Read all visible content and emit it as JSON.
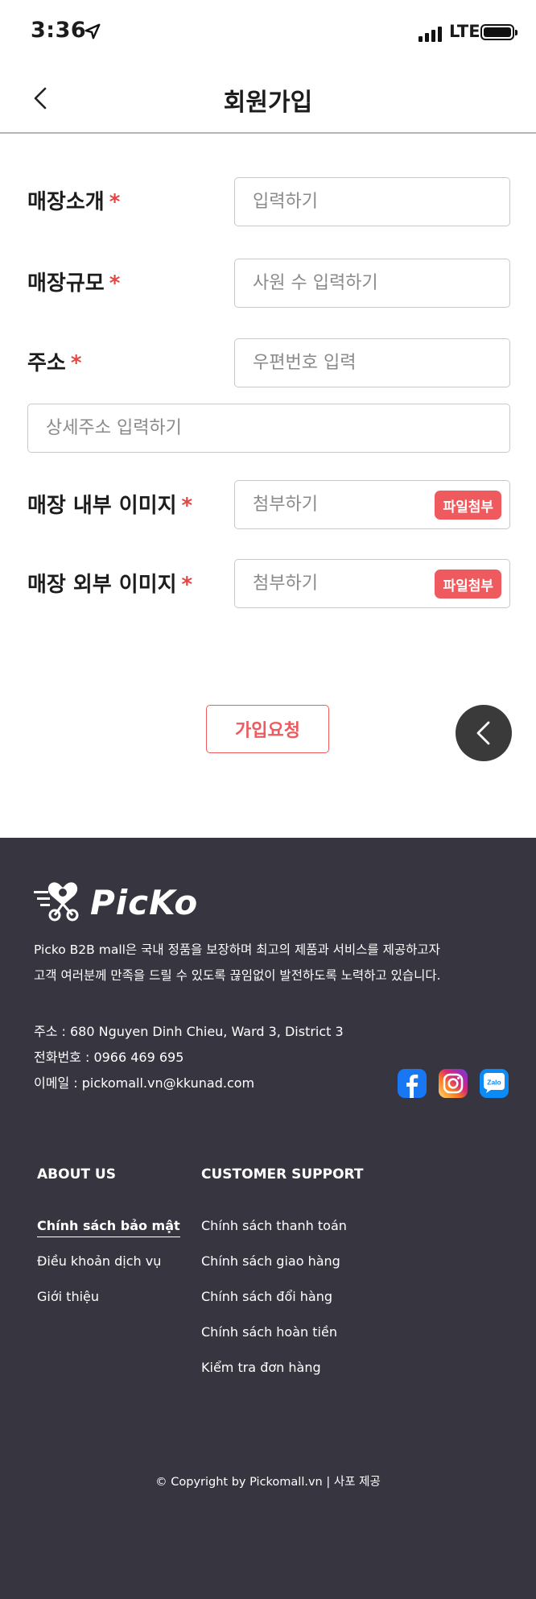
{
  "status_bar": {
    "time": "3:36",
    "network": "LTE"
  },
  "header": {
    "title": "회원가입"
  },
  "form": {
    "required_mark": "*",
    "store_intro": {
      "label": "매장소개",
      "placeholder": "입력하기"
    },
    "store_size": {
      "label": "매장규모",
      "placeholder": "사원 수 입력하기"
    },
    "address": {
      "label": "주소",
      "postal_placeholder": "우편번호 입력",
      "detail_placeholder": "상세주소 입력하기"
    },
    "interior_image": {
      "label": "매장 내부 이미지",
      "placeholder": "첨부하기",
      "button": "파일첨부"
    },
    "exterior_image": {
      "label": "매장 외부 이미지",
      "placeholder": "첨부하기",
      "button": "파일첨부"
    },
    "submit_label": "가입요청"
  },
  "footer": {
    "logo_text": "PicKo",
    "intro_line1": "Picko B2B mall은 국내 정품을 보장하며 최고의 제품과 서비스를 제공하고자",
    "intro_line2": "고객 여러분께 만족을 드릴 수 있도록 끊임없이 발전하도록 노력하고 있습니다.",
    "address": "주소 : 680 Nguyen Dinh Chieu, Ward 3, District 3",
    "phone": "전화번호 : 0966 469 695",
    "email": "이메일 : pickomall.vn@kkunad.com",
    "social": [
      {
        "name": "facebook-icon",
        "color": "#1877f2"
      },
      {
        "name": "instagram-icon",
        "color": "#d62976"
      },
      {
        "name": "zalo-icon",
        "color": "#0a8bf5",
        "text": "Zalo"
      }
    ],
    "about_us": {
      "title": "ABOUT US",
      "links": [
        "Chính sách bảo mật",
        "Điều khoản dịch vụ",
        "Giới thiệu"
      ]
    },
    "customer_support": {
      "title": "CUSTOMER SUPPORT",
      "links": [
        "Chính sách thanh toán",
        "Chính sách giao hàng",
        "Chính sách đổi hàng",
        "Chính sách hoàn tiền",
        "Kiểm tra đơn hàng"
      ]
    },
    "copyright": "© Copyright by Pickomall.vn | 사포 제공"
  },
  "colors": {
    "accent": "#ee5a5e",
    "footer_bg": "#373540"
  }
}
